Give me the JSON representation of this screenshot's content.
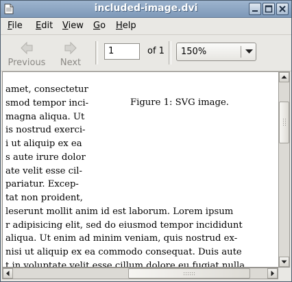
{
  "window": {
    "title": "included-image.dvi"
  },
  "menubar": {
    "items": [
      {
        "label": "File",
        "mnemonic": "F",
        "rest": "ile"
      },
      {
        "label": "Edit",
        "mnemonic": "E",
        "rest": "dit"
      },
      {
        "label": "View",
        "mnemonic": "V",
        "rest": "iew"
      },
      {
        "label": "Go",
        "mnemonic": "G",
        "rest": "o"
      },
      {
        "label": "Help",
        "mnemonic": "H",
        "rest": "elp"
      }
    ]
  },
  "toolbar": {
    "previous_label": "Previous",
    "next_label": "Next",
    "page_value": "1",
    "page_total": "of 1",
    "zoom_value": "150%"
  },
  "document": {
    "caption": "Figure 1: SVG image.",
    "narrow_lines": [
      "amet, consectetur",
      "smod tempor inci-",
      "magna aliqua. Ut",
      "is nostrud exerci-",
      "i ut aliquip ex ea",
      "s aute irure dolor",
      "ate velit esse cil-",
      "pariatur. Excep-",
      "tat non proident,"
    ],
    "wide_lines": [
      "leserunt mollit anim id est laborum.  Lorem ipsum",
      "r adipisicing elit, sed do eiusmod tempor incididunt",
      "aliqua.  Ut enim ad minim veniam, quis nostrud ex-",
      "nisi ut aliquip ex ea commodo consequat.  Duis aute",
      "t in voluptate velit esse cillum dolore eu fugiat nulla"
    ]
  },
  "colors": {
    "titlebar": "#8aa3c2",
    "window_bg": "#e9e8e4",
    "document_bg": "#ffffff"
  }
}
